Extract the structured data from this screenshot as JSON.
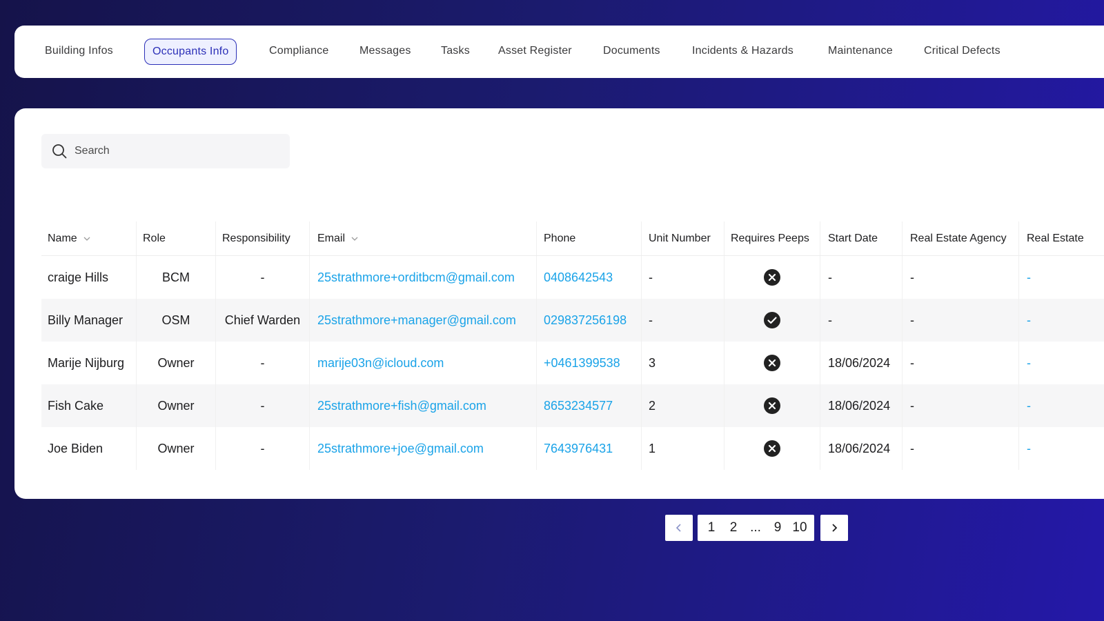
{
  "tabs": [
    {
      "label": "Building Infos",
      "active": false
    },
    {
      "label": "Occupants Info",
      "active": true
    },
    {
      "label": "Compliance",
      "active": false
    },
    {
      "label": "Messages",
      "active": false
    },
    {
      "label": "Tasks",
      "active": false
    },
    {
      "label": "Asset Register",
      "active": false
    },
    {
      "label": "Documents",
      "active": false
    },
    {
      "label": "Incidents & Hazards",
      "active": false
    },
    {
      "label": "Maintenance",
      "active": false
    },
    {
      "label": "Critical Defects",
      "active": false
    }
  ],
  "search": {
    "placeholder": "Search",
    "value": ""
  },
  "table": {
    "headers": {
      "name": "Name",
      "role": "Role",
      "responsibility": "Responsibility",
      "email": "Email",
      "phone": "Phone",
      "unit": "Unit Number",
      "peeps": "Requires Peeps",
      "start": "Start Date",
      "agency": "Real Estate Agency",
      "agency2": "Real Estate"
    },
    "rows": [
      {
        "name": "craige Hills",
        "role": "BCM",
        "responsibility": "-",
        "email": "25strathmore+orditbcm@gmail.com",
        "phone": "0408642543",
        "unit": "-",
        "peeps": "no",
        "start": "-",
        "agency": "-",
        "agency2": "-"
      },
      {
        "name": "Billy Manager",
        "role": "OSM",
        "responsibility": "Chief Warden",
        "email": "25strathmore+manager@gmail.com",
        "phone": "029837256198",
        "unit": "-",
        "peeps": "yes",
        "start": "-",
        "agency": "-",
        "agency2": "-"
      },
      {
        "name": "Marije Nijburg",
        "role": "Owner",
        "responsibility": "-",
        "email": "marije03n@icloud.com",
        "phone": "+0461399538",
        "unit": "3",
        "peeps": "no",
        "start": "18/06/2024",
        "agency": "-",
        "agency2": "-"
      },
      {
        "name": "Fish Cake",
        "role": "Owner",
        "responsibility": "-",
        "email": "25strathmore+fish@gmail.com",
        "phone": "8653234577",
        "unit": "2",
        "peeps": "no",
        "start": "18/06/2024",
        "agency": "-",
        "agency2": "-"
      },
      {
        "name": "Joe Biden",
        "role": "Owner",
        "responsibility": "-",
        "email": "25strathmore+joe@gmail.com",
        "phone": "7643976431",
        "unit": "1",
        "peeps": "no",
        "start": "18/06/2024",
        "agency": "-",
        "agency2": "-"
      }
    ]
  },
  "pagination": {
    "pages": [
      "1",
      "2",
      "...",
      "9",
      "10"
    ],
    "prev_icon": "chevron-left-icon",
    "next_icon": "chevron-right-icon"
  },
  "colors": {
    "accent": "#2b2fb7",
    "link": "#1aa3e8",
    "background_start": "#15134a",
    "background_end": "#2418a8"
  }
}
